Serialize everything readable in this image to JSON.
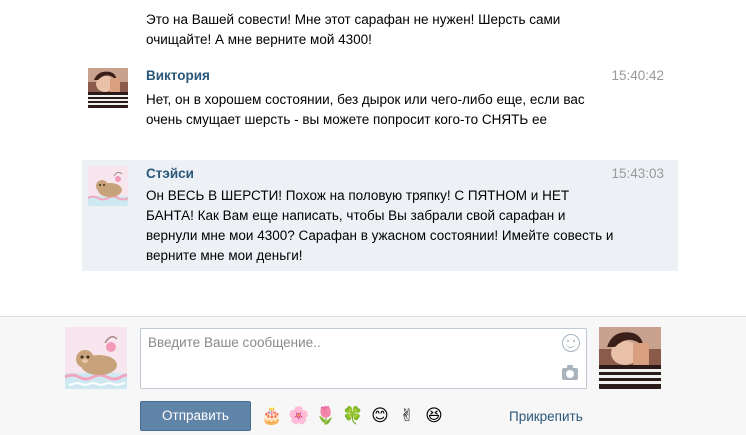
{
  "prev_message": {
    "text": "Это на Вашей совести! Мне этот сарафан не нужен! Шерсть сами очищайте! А мне верните мой 4300!"
  },
  "messages": [
    {
      "author": "Виктория",
      "time": "15:40:42",
      "text": "Нет, он в хорошем состоянии, без дырок или чего-либо еще, если вас очень смущает шерсть - вы можете попросит кого-то СНЯТЬ ее"
    },
    {
      "author": "Стэйси",
      "time": "15:43:03",
      "text": "Он ВЕСЬ В ШЕРСТИ! Похож на половую тряпку! С ПЯТНОМ и НЕТ БАНТА! Как Вам еще написать, чтобы Вы забрали свой сарафан и вернули мне мои 4300? Сарафан в ужасном состоянии! Имейте совесть и верните мне мои деньги!"
    }
  ],
  "composer": {
    "placeholder": "Введите Ваше сообщение..",
    "send_label": "Отправить",
    "attach_label": "Прикрепить",
    "emojis": [
      "🎂",
      "🌸",
      "🌷",
      "🍀",
      "😊",
      "✌",
      "😆"
    ]
  },
  "colors": {
    "author_link": "#2b587a",
    "highlight_bg": "#edf1f5",
    "send_button": "#6083a8",
    "time": "#999999"
  }
}
